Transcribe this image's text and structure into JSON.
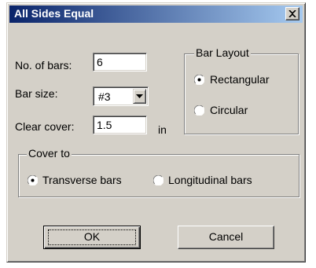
{
  "window": {
    "title": "All Sides Equal",
    "close_glyph": "close-icon"
  },
  "fields": {
    "num_bars_label": "No. of bars:",
    "num_bars_value": "6",
    "bar_size_label": "Bar size:",
    "bar_size_value": "#3",
    "clear_cover_label": "Clear cover:",
    "clear_cover_value": "1.5",
    "clear_cover_unit": "in"
  },
  "bar_layout": {
    "legend": "Bar Layout",
    "options": [
      {
        "label": "Rectangular",
        "selected": true
      },
      {
        "label": "Circular",
        "selected": false
      }
    ]
  },
  "cover_to": {
    "legend": "Cover to",
    "options": [
      {
        "label": "Transverse bars",
        "selected": true
      },
      {
        "label": "Longitudinal bars",
        "selected": false
      }
    ]
  },
  "buttons": {
    "ok_label": "OK",
    "cancel_label": "Cancel"
  },
  "colors": {
    "title_start": "#0a246a",
    "title_end": "#a6caf0",
    "face": "#d4d0c8"
  }
}
